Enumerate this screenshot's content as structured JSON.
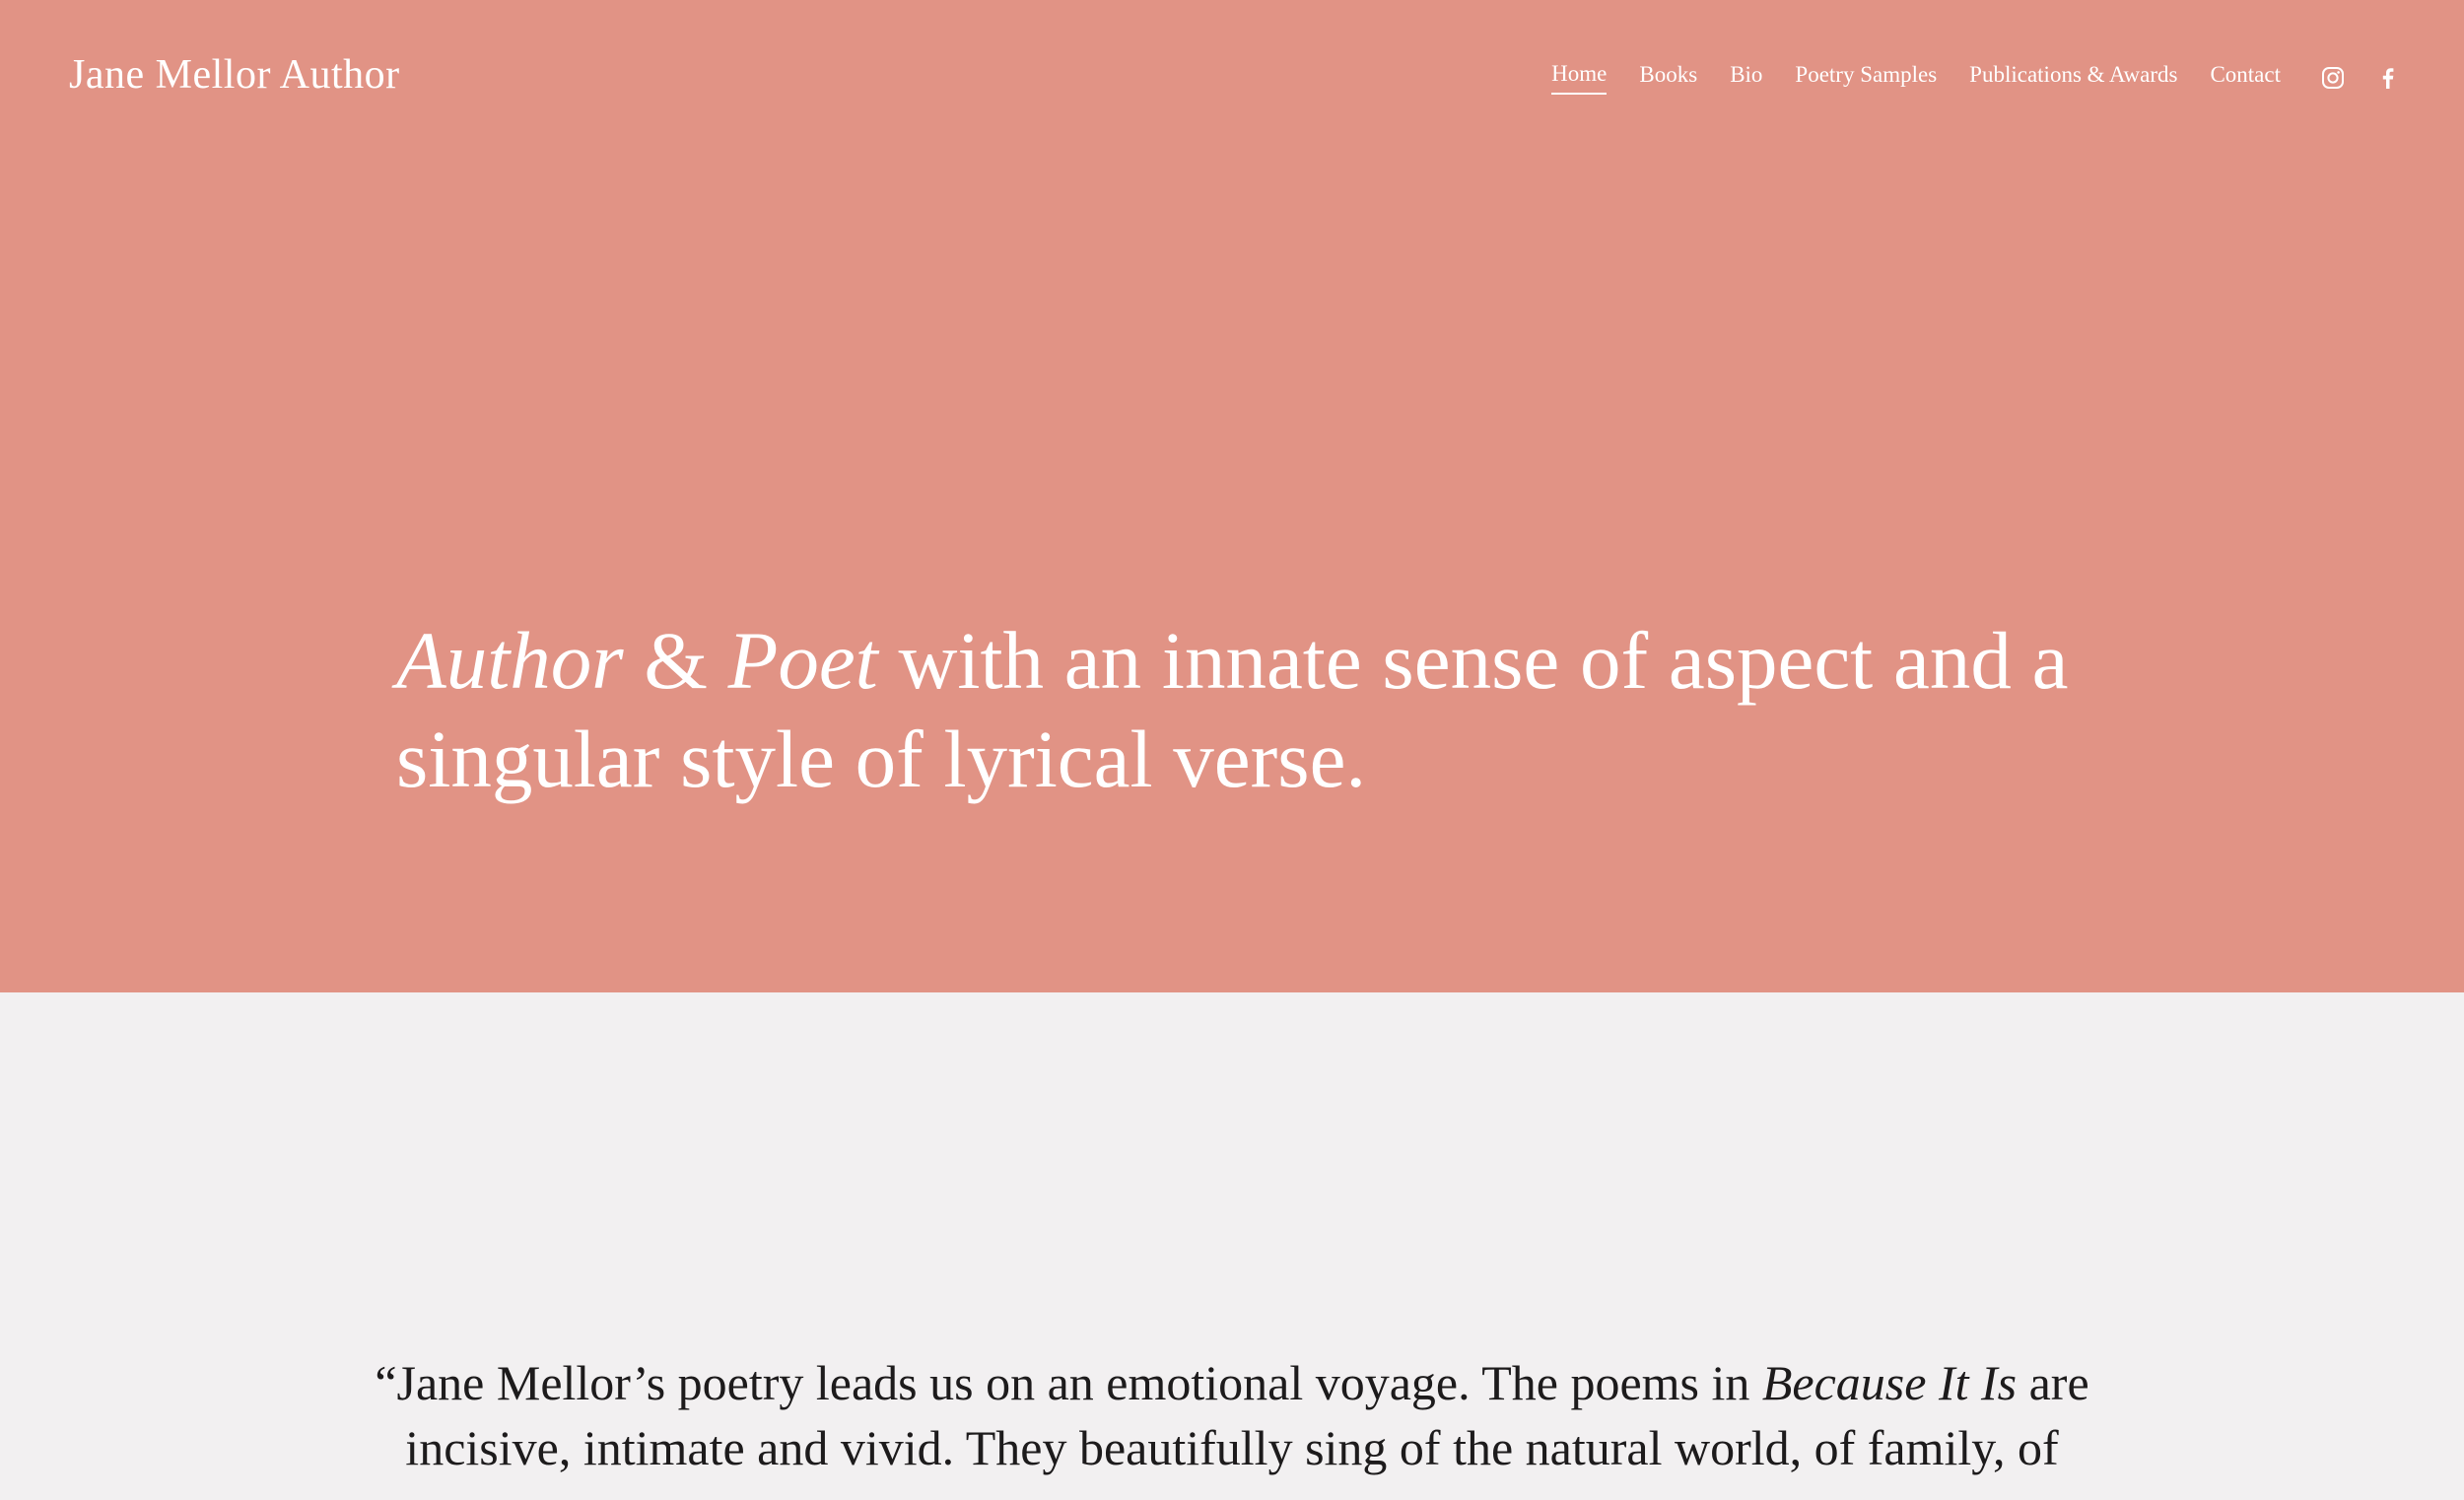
{
  "colors": {
    "hero_background": "#e19385",
    "page_background": "#f2f0f1",
    "hero_text": "#ffffff",
    "body_text": "#1d1b1c"
  },
  "header": {
    "site_title": "Jane Mellor Author",
    "nav": [
      {
        "label": "Home",
        "active": true
      },
      {
        "label": "Books",
        "active": false
      },
      {
        "label": "Bio",
        "active": false
      },
      {
        "label": "Poetry Samples",
        "active": false
      },
      {
        "label": "Publications & Awards",
        "active": false
      },
      {
        "label": "Contact",
        "active": false
      }
    ],
    "social_icons": [
      "instagram-icon",
      "facebook-icon"
    ]
  },
  "hero": {
    "headline_part1": "Author",
    "headline_amp": " & ",
    "headline_part2": "Poet",
    "headline_rest": " with an innate sense of aspect and a singular style of lyrical verse."
  },
  "testimonial": {
    "quote_start": "“Jane Mellor’s poetry leads us on an emotional voyage. The poems in ",
    "book_title": "Because It Is",
    "quote_end": " are incisive, intimate and vivid. They beautifully sing of the natural world, of family, of"
  }
}
